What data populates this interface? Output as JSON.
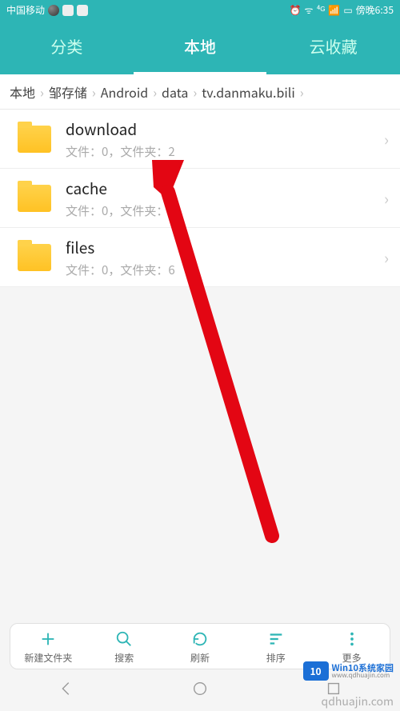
{
  "status": {
    "carrier": "中国移动",
    "time": "傍晚6:35"
  },
  "tabs": [
    {
      "label": "分类",
      "active": false
    },
    {
      "label": "本地",
      "active": true
    },
    {
      "label": "云收藏",
      "active": false
    }
  ],
  "breadcrumb": [
    "本地",
    "邹存储",
    "Android",
    "data",
    "tv.danmaku.bili"
  ],
  "folders": [
    {
      "name": "download",
      "sub": "文件：0，文件夹：2"
    },
    {
      "name": "cache",
      "sub": "文件：0，文件夹：4"
    },
    {
      "name": "files",
      "sub": "文件：0，文件夹：6"
    }
  ],
  "bottom": [
    {
      "label": "新建文件夹"
    },
    {
      "label": "搜索"
    },
    {
      "label": "刷新"
    },
    {
      "label": "排序"
    },
    {
      "label": "更多"
    }
  ],
  "watermark": {
    "badge": "10",
    "line1": "Win10系统家园",
    "line2": "www.qdhuajin.com",
    "url": "qdhuajin.com"
  }
}
